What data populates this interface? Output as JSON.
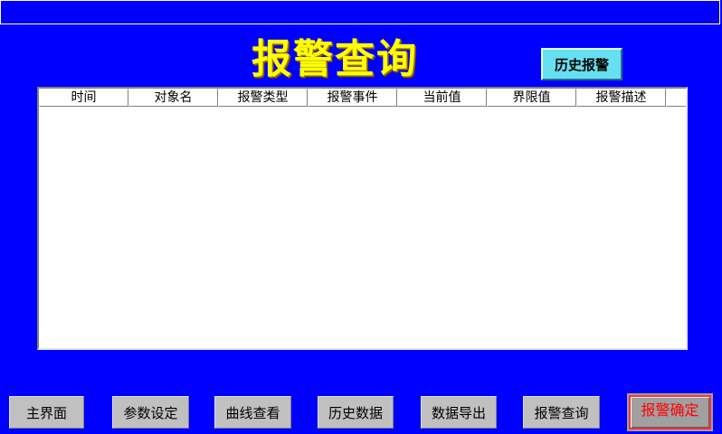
{
  "header": {
    "title": "报警查询",
    "history_button": "历史报警"
  },
  "alarm_table": {
    "columns": [
      "时间",
      "对象名",
      "报警类型",
      "报警事件",
      "当前值",
      "界限值",
      "报警描述"
    ],
    "rows": []
  },
  "nav": {
    "main": "主界面",
    "params": "参数设定",
    "curve": "曲线查看",
    "history_data": "历史数据",
    "export": "数据导出",
    "alarm_query": "报警查询",
    "alarm_ack": "报警确定"
  },
  "colors": {
    "background": "#0000ff",
    "title": "#ffff00",
    "history_button_bg": "#66e0f0",
    "nav_button_bg": "#c0c0c0",
    "alarm_ack_text": "#ff0000"
  }
}
